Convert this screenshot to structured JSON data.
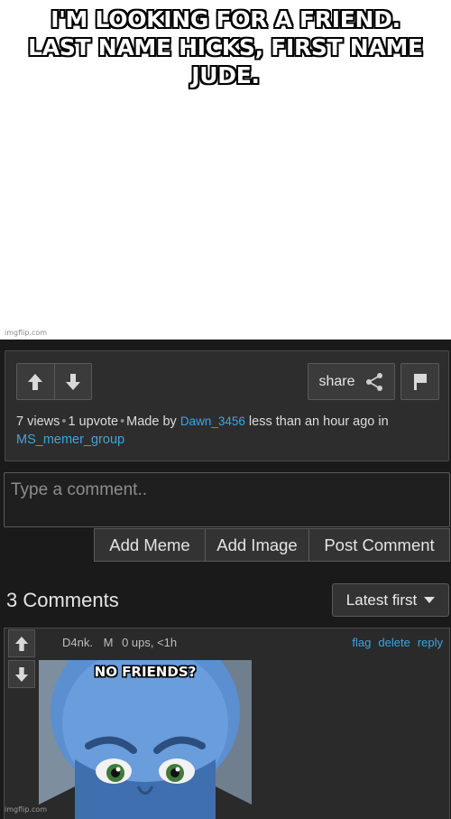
{
  "meme": {
    "caption_line1": "I'M LOOKING FOR A FRIEND.",
    "caption_line2": "LAST NAME HICKS, FIRST NAME JUDE.",
    "watermark": "imgflip.com"
  },
  "post": {
    "share_label": "share",
    "views": "7 views",
    "upvotes": "1 upvote",
    "made_by_prefix": "Made by",
    "author": "Dawn_3456",
    "time_text": "less than an hour ago in",
    "stream": "MS_memer_group"
  },
  "comment_form": {
    "placeholder": "Type a comment..",
    "add_meme": "Add Meme",
    "add_image": "Add Image",
    "post_comment": "Post Comment"
  },
  "comments_section": {
    "title": "3 Comments",
    "sort_label": "Latest first"
  },
  "comment": {
    "user": "D4nk.",
    "badge": "M",
    "stats": "0 ups, <1h",
    "flag": "flag",
    "delete": "delete",
    "reply": "reply",
    "image_caption": "NO FRIENDS?"
  },
  "bottom_watermark": "imgflip.com",
  "colors": {
    "link": "#3aa6e5",
    "panel_bg": "#2d2d2d",
    "page_dark": "#1a1a1a"
  }
}
